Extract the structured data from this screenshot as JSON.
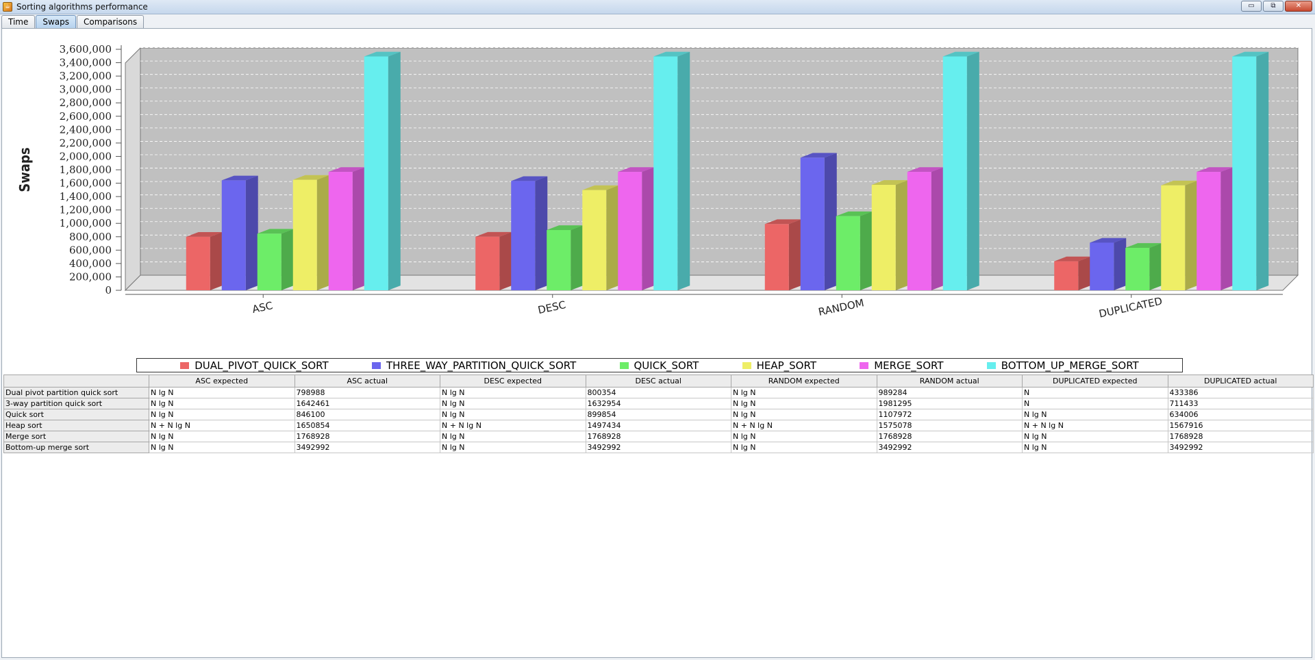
{
  "window": {
    "title": "Sorting algorithms performance",
    "minimize_glyph": "▭",
    "maximize_glyph": "⧉",
    "close_glyph": "✕"
  },
  "tabs": [
    {
      "label": "Time",
      "active": false
    },
    {
      "label": "Swaps",
      "active": true
    },
    {
      "label": "Comparisons",
      "active": false
    }
  ],
  "chart_data": {
    "type": "bar",
    "style": "3d-clustered",
    "title": "",
    "xlabel": "",
    "ylabel": "Swaps",
    "ylim": [
      0,
      3600000
    ],
    "ytick_step": 200000,
    "grid": true,
    "legend_position": "bottom",
    "plot_background": "#c0c0c0",
    "categories": [
      "ASC",
      "DESC",
      "RANDOM",
      "DUPLICATED"
    ],
    "series": [
      {
        "name": "DUAL_PIVOT_QUICK_SORT",
        "color": "#ec6666",
        "values": [
          798988,
          800354,
          989284,
          433386
        ]
      },
      {
        "name": "THREE_WAY_PARTITION_QUICK_SORT",
        "color": "#6b66ee",
        "values": [
          1642461,
          1632954,
          1981295,
          711433
        ]
      },
      {
        "name": "QUICK_SORT",
        "color": "#6ded68",
        "values": [
          846100,
          899854,
          1107972,
          634006
        ]
      },
      {
        "name": "HEAP_SORT",
        "color": "#eeee66",
        "values": [
          1650854,
          1497434,
          1575078,
          1567916
        ]
      },
      {
        "name": "MERGE_SORT",
        "color": "#ee66ee",
        "values": [
          1768928,
          1768928,
          1768928,
          1768928
        ]
      },
      {
        "name": "BOTTOM_UP_MERGE_SORT",
        "color": "#66eeee",
        "values": [
          3492992,
          3492992,
          3492992,
          3492992
        ]
      }
    ]
  },
  "table": {
    "columns": [
      "",
      "ASC expected",
      "ASC actual",
      "DESC expected",
      "DESC actual",
      "RANDOM expected",
      "RANDOM actual",
      "DUPLICATED expected",
      "DUPLICATED actual"
    ],
    "rows": [
      [
        "Dual pivot partition quick sort",
        "N lg N",
        "798988",
        "N lg N",
        "800354",
        "N lg N",
        "989284",
        "N",
        "433386"
      ],
      [
        "3-way partition quick sort",
        "N lg N",
        "1642461",
        "N lg N",
        "1632954",
        "N lg N",
        "1981295",
        "N",
        "711433"
      ],
      [
        "Quick sort",
        "N lg N",
        "846100",
        "N lg N",
        "899854",
        "N lg N",
        "1107972",
        "N lg N",
        "634006"
      ],
      [
        "Heap sort",
        "N + N lg N",
        "1650854",
        "N + N lg N",
        "1497434",
        "N + N lg N",
        "1575078",
        "N + N lg N",
        "1567916"
      ],
      [
        "Merge sort",
        "N lg N",
        "1768928",
        "N lg N",
        "1768928",
        "N lg N",
        "1768928",
        "N lg N",
        "1768928"
      ],
      [
        "Bottom-up merge sort",
        "N lg N",
        "3492992",
        "N lg N",
        "3492992",
        "N lg N",
        "3492992",
        "N lg N",
        "3492992"
      ]
    ]
  }
}
